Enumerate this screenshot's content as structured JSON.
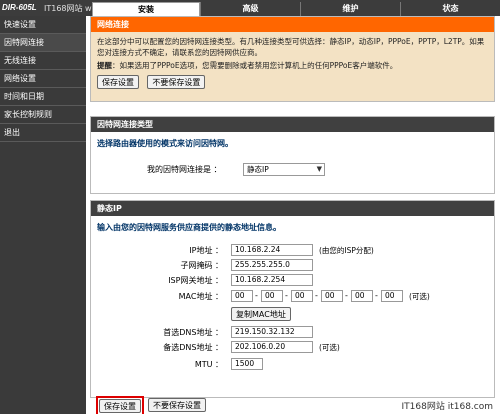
{
  "header": {
    "model": "DIR-605L",
    "watermark_top": "IT168网站 www.it168.com",
    "tabs": [
      {
        "label": "安装",
        "active": true
      },
      {
        "label": "高级",
        "active": false
      },
      {
        "label": "维护",
        "active": false
      },
      {
        "label": "状态",
        "active": false
      }
    ]
  },
  "sidebar": {
    "items": [
      {
        "label": "快速设置"
      },
      {
        "label": "因特网连接"
      },
      {
        "label": "无线连接"
      },
      {
        "label": "网络设置"
      },
      {
        "label": "时间和日期"
      },
      {
        "label": "家长控制规则"
      },
      {
        "label": "退出"
      }
    ]
  },
  "internet": {
    "title": "网络连接",
    "description": "在这部分中可以配置您的因特网连接类型。有几种连接类型可供选择：静态IP，动态IP，PPPoE，PPTP，L2TP。如果您对连接方式不确定，请联系您的因特网供应商。",
    "note_label": "提醒",
    "note_text": "：如果选用了PPPoE选项，您需要删除或者禁用您计算机上的任何PPPoE客户端软件。",
    "save_label": "保存设置",
    "nosave_label": "不要保存设置"
  },
  "conn_type": {
    "title": "因特网连接类型",
    "prompt": "选择路由器使用的模式来访问因特网。",
    "select_label": "我的因特网连接是 ：",
    "select_value": "静态IP"
  },
  "static_ip": {
    "title": "静态IP",
    "prompt": "输入由您的因特网服务供应商提供的静态地址信息。",
    "fields": {
      "ip": {
        "label": "IP地址 ：",
        "value": "10.168.2.24",
        "hint": "(由您的ISP分配)"
      },
      "mask": {
        "label": "子网掩码 ：",
        "value": "255.255.255.0"
      },
      "gateway": {
        "label": "ISP网关地址 ：",
        "value": "10.168.2.254"
      },
      "mac": {
        "label": "MAC地址 ：",
        "values": [
          "00",
          "00",
          "00",
          "00",
          "00",
          "00"
        ],
        "hint": "(可选)"
      },
      "clone_label": "复制MAC地址",
      "dns1": {
        "label": "首选DNS地址 ：",
        "value": "219.150.32.132"
      },
      "dns2": {
        "label": "备选DNS地址 ：",
        "value": "202.106.0.20",
        "hint": "(可选)"
      },
      "mtu": {
        "label": "MTU ：",
        "value": "1500"
      }
    }
  },
  "footer": {
    "save_label": "保存设置",
    "nosave_label": "不要保存设置",
    "watermark": "IT168网站 it168.com"
  }
}
